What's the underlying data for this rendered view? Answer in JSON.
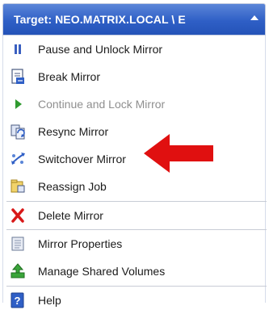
{
  "header": {
    "title": "Target: NEO.MATRIX.LOCAL \\ E",
    "collapse_icon": "chevron-up-icon"
  },
  "menu": {
    "items": [
      {
        "label": "Pause and Unlock Mirror",
        "icon": "pause-icon",
        "enabled": true
      },
      {
        "label": "Break Mirror",
        "icon": "break-mirror-icon",
        "enabled": true
      },
      {
        "label": "Continue and Lock Mirror",
        "icon": "play-icon",
        "enabled": false
      },
      {
        "label": "Resync Mirror",
        "icon": "resync-icon",
        "enabled": true
      },
      {
        "label": "Switchover Mirror",
        "icon": "switchover-icon",
        "enabled": true
      },
      {
        "label": "Reassign Job",
        "icon": "reassign-job-icon",
        "enabled": true
      },
      {
        "label": "Delete Mirror",
        "icon": "delete-icon",
        "enabled": true
      },
      {
        "label": "Mirror Properties",
        "icon": "properties-icon",
        "enabled": true
      },
      {
        "label": "Manage Shared Volumes",
        "icon": "shared-volumes-icon",
        "enabled": true
      },
      {
        "label": "Help",
        "icon": "help-icon",
        "enabled": true
      }
    ]
  },
  "annotation": {
    "arrow_color": "#e01010",
    "points_to": "Switchover Mirror"
  },
  "colors": {
    "header_bg": "#2f5fc6",
    "header_text": "#ffffff",
    "disabled_text": "#8f8f8f"
  }
}
